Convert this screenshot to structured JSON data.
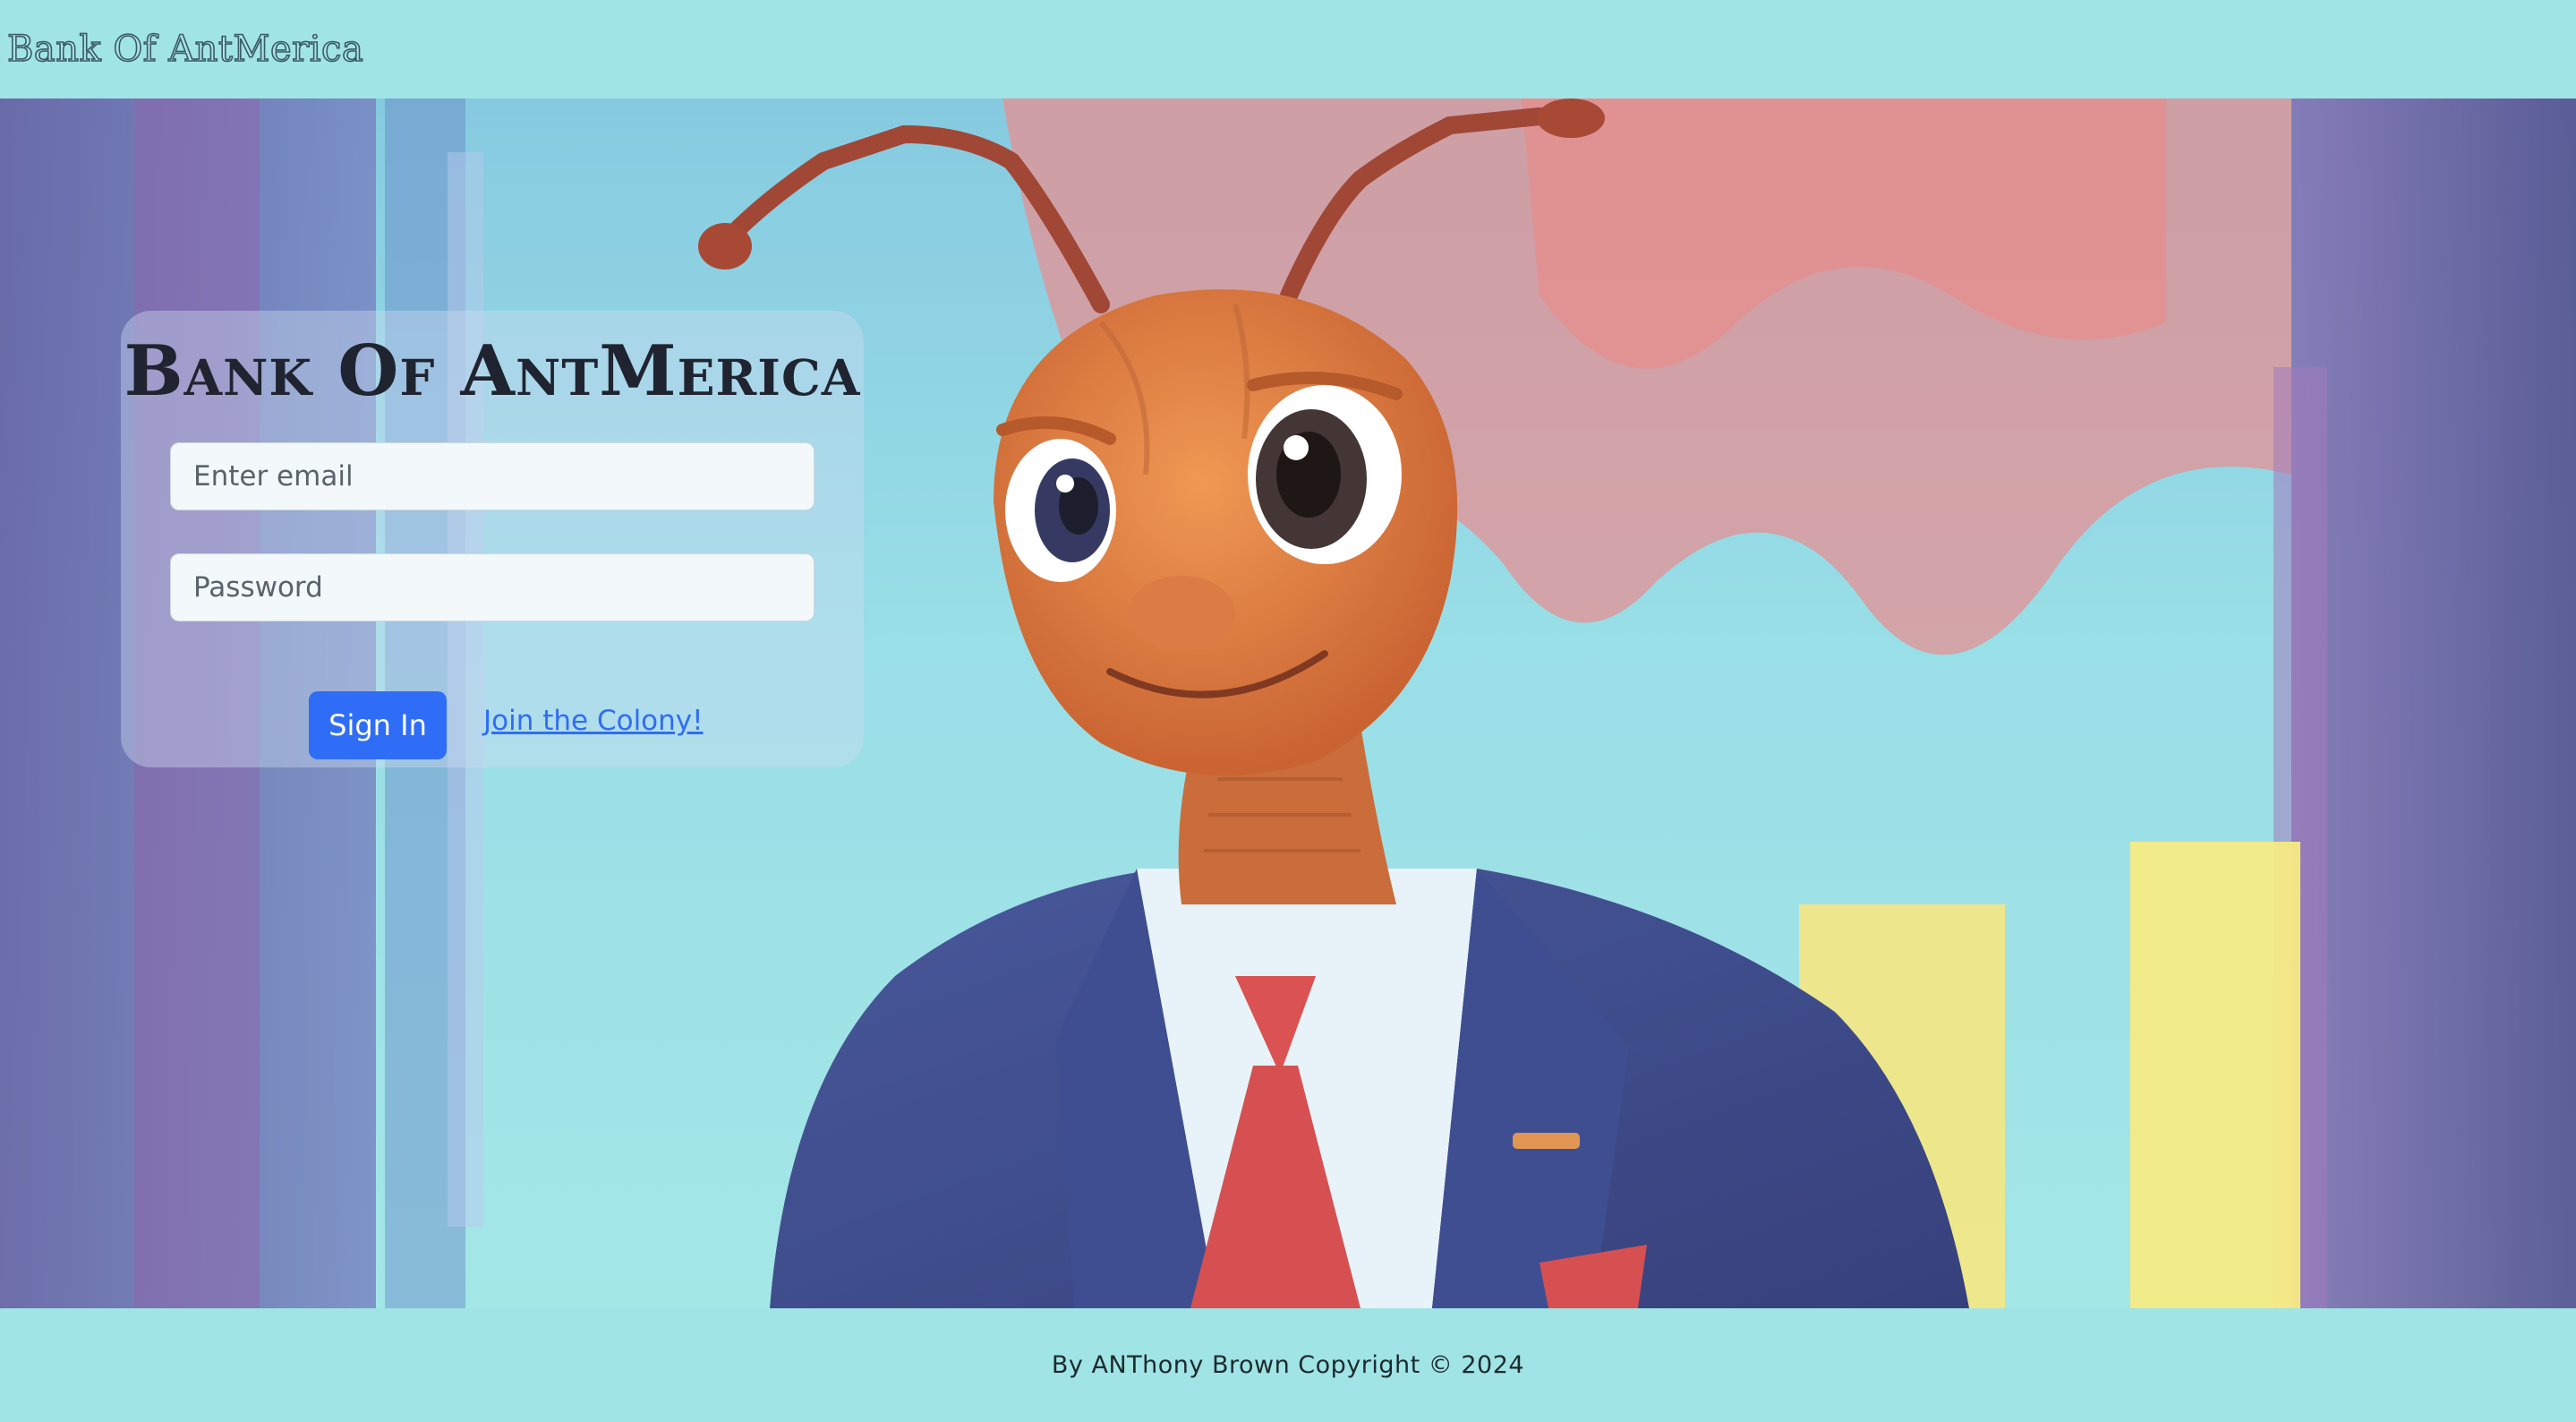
{
  "navbar": {
    "brand": "Bank Of AntMerica"
  },
  "hero": {
    "image": "ant-in-suit-illustration"
  },
  "login": {
    "title": "Bank Of AntMerica",
    "email_placeholder": "Enter email",
    "password_placeholder": "Password",
    "signin_label": "Sign In",
    "join_label": "Join the Colony!"
  },
  "footer": {
    "copyright": "By ANThony Brown Copyright © 2024"
  },
  "colors": {
    "primary_button": "#2f6df6",
    "bar_background": "#a0e4e6"
  }
}
